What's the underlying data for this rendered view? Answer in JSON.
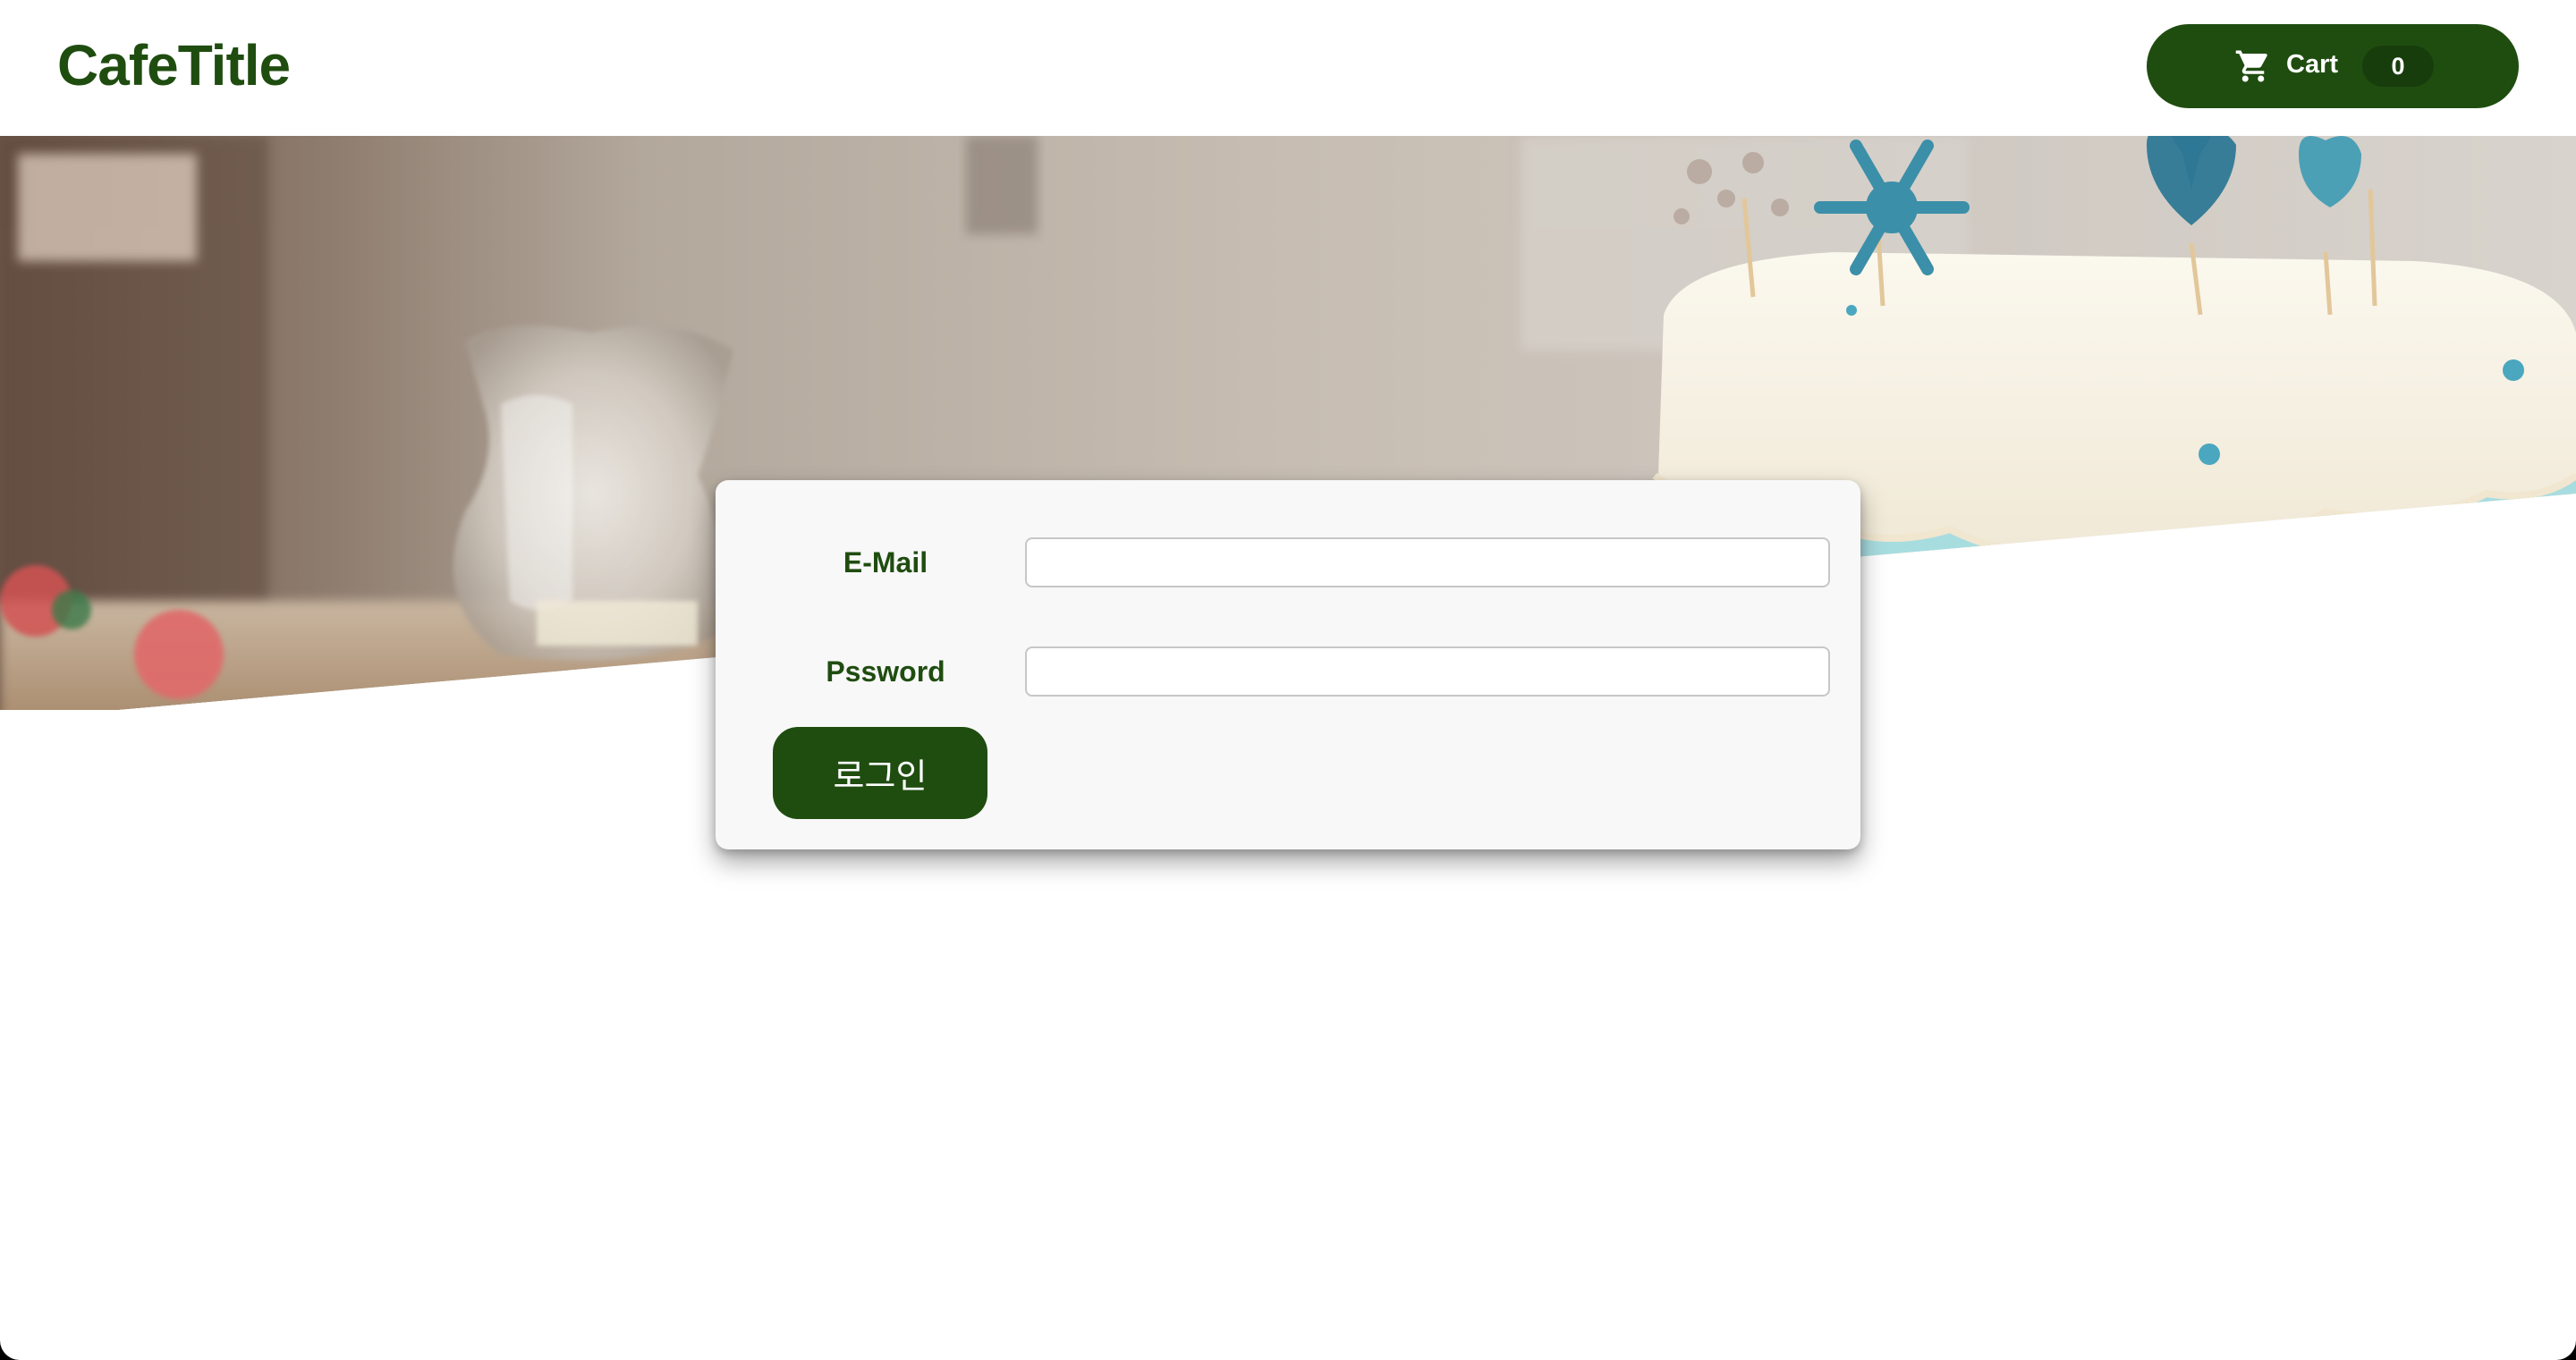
{
  "header": {
    "site_title": "CafeTitle",
    "cart_label": "Cart",
    "cart_count": "0"
  },
  "login": {
    "email_label": "E-Mail",
    "email_value": "",
    "password_label": "Pssword",
    "password_value": "",
    "submit_label": "로그인"
  },
  "hero": {
    "image_subject": "cafe cake with snowflake and heart toppers, glass vase"
  },
  "icons": {
    "cart": "cart-icon"
  },
  "colors": {
    "brand_green": "#1f4d10",
    "card_background": "#f8f8f8",
    "page_background": "#ffffff"
  }
}
